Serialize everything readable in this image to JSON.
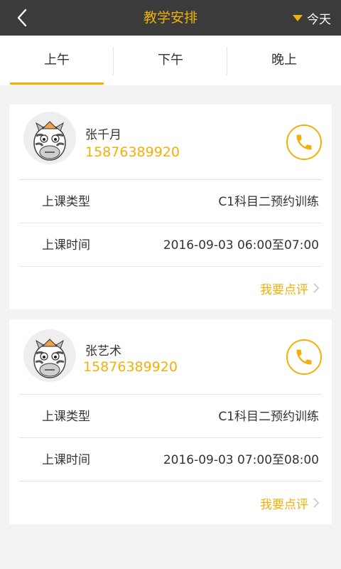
{
  "header": {
    "title": "教学安排",
    "date_filter": "今天",
    "colors": {
      "bar": "#3b3b3b",
      "accent": "#f1b10a"
    }
  },
  "tabs": [
    {
      "label": "上午",
      "active": true
    },
    {
      "label": "下午",
      "active": false
    },
    {
      "label": "晚上",
      "active": false
    }
  ],
  "appointments": [
    {
      "name": "张千月",
      "phone": "15876389920",
      "type_label": "上课类型",
      "type_value": "C1科目二预约训练",
      "time_label": "上课时间",
      "time_value": "2016-09-03 06:00至07:00",
      "review_label": "我要点评"
    },
    {
      "name": "张艺术",
      "phone": "15876389920",
      "type_label": "上课类型",
      "type_value": "C1科目二预约训练",
      "time_label": "上课时间",
      "time_value": "2016-09-03 07:00至08:00",
      "review_label": "我要点评"
    }
  ],
  "icons": [
    "back-arrow-icon",
    "dropdown-triangle-icon",
    "zebra-avatar-icon",
    "phone-icon",
    "chevron-right-icon"
  ]
}
